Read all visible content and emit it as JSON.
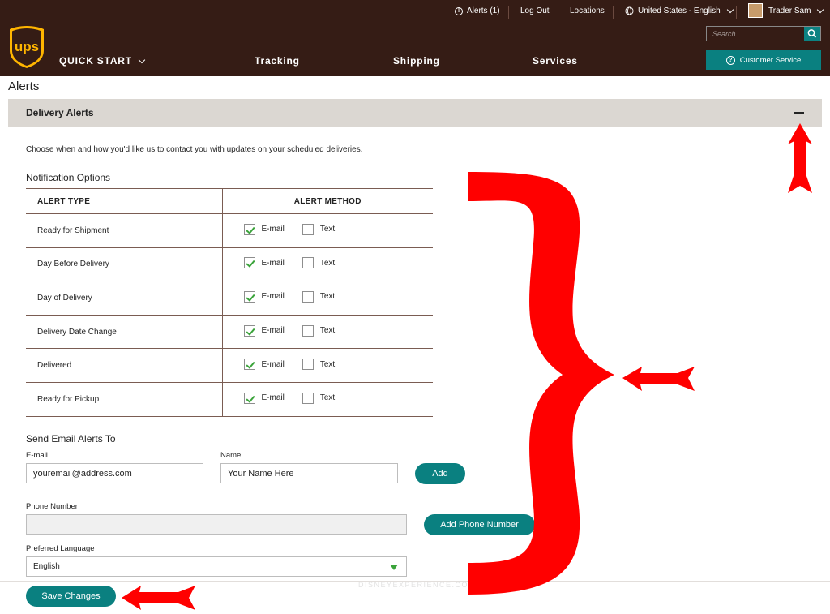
{
  "header": {
    "utility": {
      "alerts": "Alerts (1)",
      "logout": "Log Out",
      "locations": "Locations",
      "locale": "United States - English",
      "user": "Trader Sam"
    },
    "logo_text": "ups",
    "nav": {
      "quick_start": "QUICK START",
      "tracking": "Tracking",
      "shipping": "Shipping",
      "services": "Services"
    },
    "search_placeholder": "Search",
    "customer_service": "Customer Service"
  },
  "page_title": "Alerts",
  "panel": {
    "title": "Delivery Alerts",
    "description": "Choose when and how you'd like us to contact you with updates on your scheduled deliveries."
  },
  "notification": {
    "title": "Notification Options",
    "col_type": "ALERT TYPE",
    "col_method": "ALERT METHOD",
    "email_label": "E-mail",
    "text_label": "Text",
    "rows": [
      {
        "type": "Ready for Shipment",
        "email": true,
        "text": false
      },
      {
        "type": "Day Before Delivery",
        "email": true,
        "text": false
      },
      {
        "type": "Day of Delivery",
        "email": true,
        "text": false
      },
      {
        "type": "Delivery Date Change",
        "email": true,
        "text": false
      },
      {
        "type": "Delivered",
        "email": true,
        "text": false
      },
      {
        "type": "Ready for Pickup",
        "email": true,
        "text": false
      }
    ]
  },
  "send_email": {
    "title": "Send Email Alerts To",
    "email_label": "E-mail",
    "email_value": "youremail@address.com",
    "name_label": "Name",
    "name_value": "Your Name Here",
    "add_button": "Add"
  },
  "phone": {
    "label": "Phone Number",
    "value": "",
    "add_button": "Add Phone Number"
  },
  "language": {
    "label": "Preferred Language",
    "selected": "English"
  },
  "save_button": "Save Changes",
  "watermark": "DISNEYEXPERIENCE.COM",
  "colors": {
    "brand_brown": "#351c15",
    "brand_gold": "#ffb500",
    "accent_teal": "#0a8080",
    "check_green": "#3aa33a",
    "annotation_red": "#ff0000"
  }
}
